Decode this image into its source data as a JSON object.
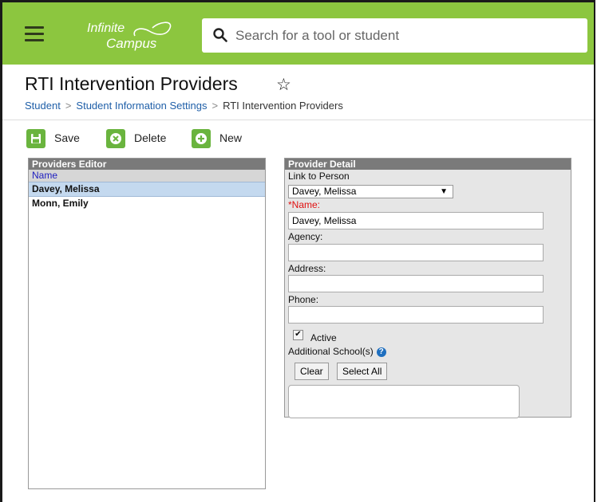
{
  "header": {
    "logo_line1": "Infinite",
    "logo_line2": "Campus",
    "search_placeholder": "Search for a tool or student",
    "menu_icon": "hamburger-icon",
    "search_icon": "magnifier-icon",
    "brand_color": "#8cc63f"
  },
  "page": {
    "title": "RTI Intervention Providers",
    "star_icon": "☆"
  },
  "breadcrumb": {
    "items": [
      "Student",
      "Student Information Settings",
      "RTI Intervention Providers"
    ],
    "separator": ">"
  },
  "toolbar": {
    "save_label": "Save",
    "delete_label": "Delete",
    "new_label": "New",
    "icon_color": "#6ab43e"
  },
  "providers_editor": {
    "title": "Providers Editor",
    "column_header": "Name",
    "rows": [
      "Davey, Melissa",
      "Monn, Emily"
    ],
    "selected_index": 0
  },
  "provider_detail": {
    "title": "Provider Detail",
    "link_to_person_label": "Link to Person",
    "link_to_person_value": "Davey, Melissa",
    "name_label": "*Name:",
    "name_value": "Davey, Melissa",
    "agency_label": "Agency:",
    "agency_value": "",
    "address_label": "Address:",
    "address_value": "",
    "phone_label": "Phone:",
    "phone_value": "",
    "active_label": "Active",
    "active_checked": true,
    "additional_schools_label": "Additional School(s)",
    "help_icon": "?",
    "clear_label": "Clear",
    "select_all_label": "Select All"
  }
}
